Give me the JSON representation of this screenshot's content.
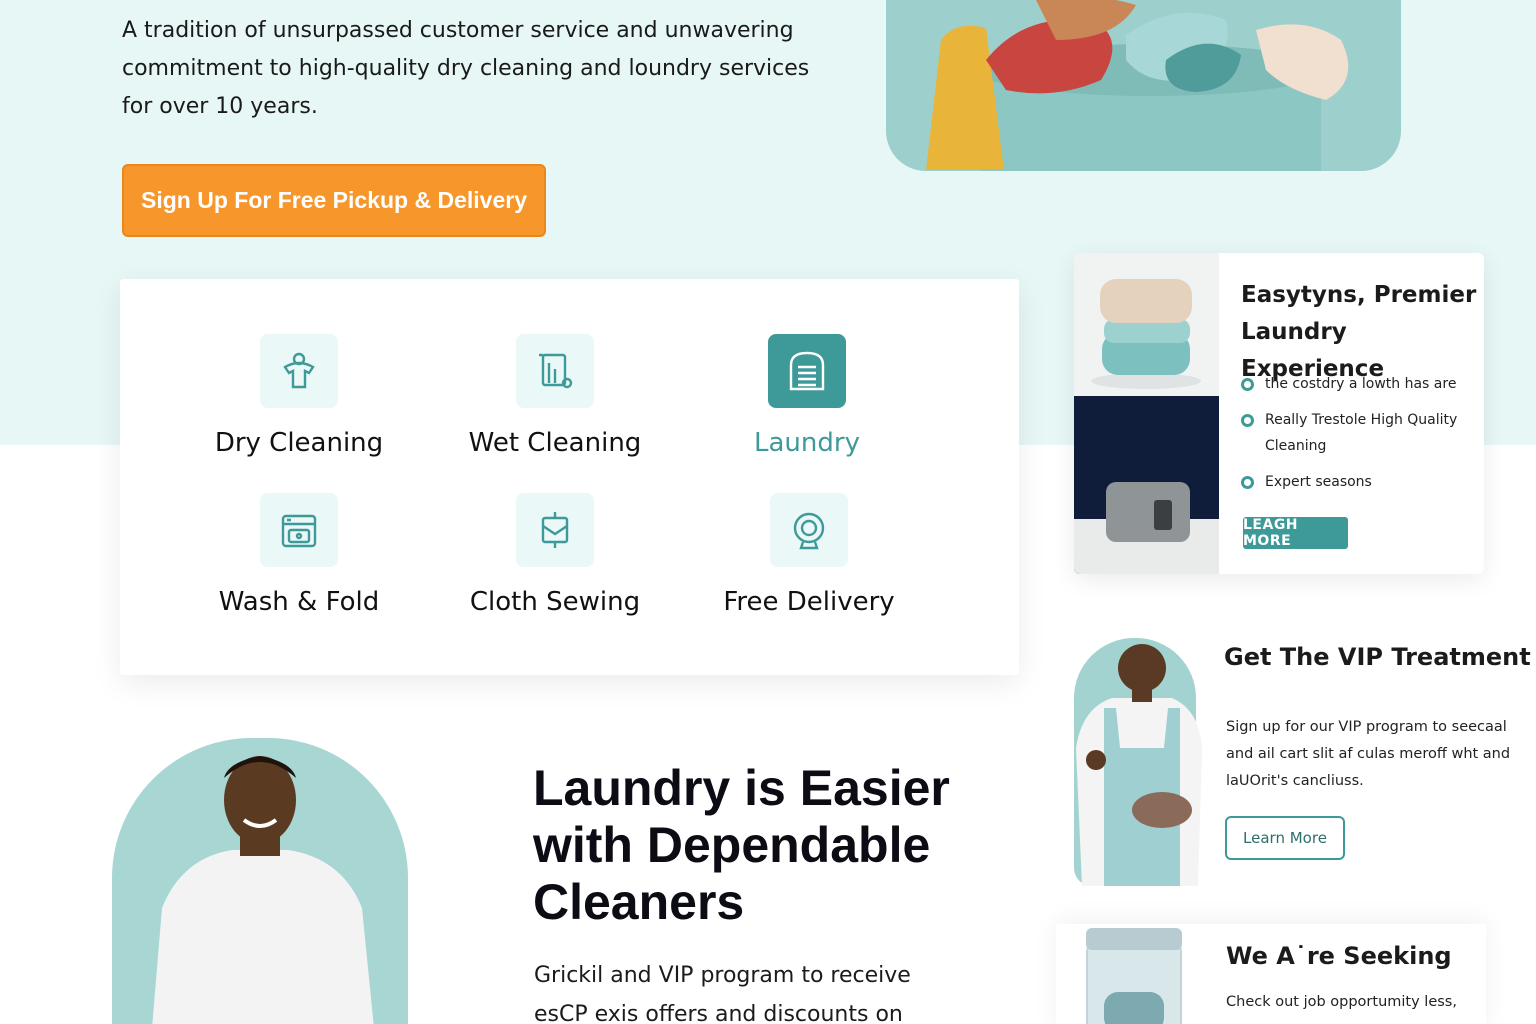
{
  "hero": {
    "text": "A tradition of unsurpassed customer service and unwavering commitment to high-quality dry cleaning and loundry services for over 10 years.",
    "cta_label": "Sign Up For Free Pickup & Delivery"
  },
  "services": [
    {
      "label": "Dry Cleaning",
      "icon": "dry-cleaning-icon"
    },
    {
      "label": "Wet Cleaning",
      "icon": "wet-cleaning-icon"
    },
    {
      "label": "Laundry",
      "icon": "laundry-icon",
      "active": true
    },
    {
      "label": "Wash & Fold",
      "icon": "washing-machine-icon"
    },
    {
      "label": "Cloth Sewing",
      "icon": "sewing-icon"
    },
    {
      "label": "Free Delivery",
      "icon": "delivery-icon"
    }
  ],
  "premier_card": {
    "title": "Easytyns, Premier Laundry Experience",
    "items": [
      "the costdry a lowth has are",
      "Really Trestole High Quality Cleaning",
      "Expert seasons"
    ],
    "button": "LEAGH MORE"
  },
  "vip": {
    "title": "Get The VIP Treatment",
    "text": "Sign up for our VIP program to seecaal and ail cart slit af culas meroff wht and laUOrit's cancliuss.",
    "button": "Learn More"
  },
  "seeking": {
    "title": "We A˙re Seeking",
    "text": "Check out job opportumity less,"
  },
  "easier": {
    "heading": "Laundry is Easier with Dependable Cleaners",
    "text": "Grickil and VIP program to receive esCP exis offers and discounts on"
  },
  "colors": {
    "accent": "#3d9a98",
    "cta": "#f7962b",
    "hero_bg": "#e6f7f6"
  }
}
